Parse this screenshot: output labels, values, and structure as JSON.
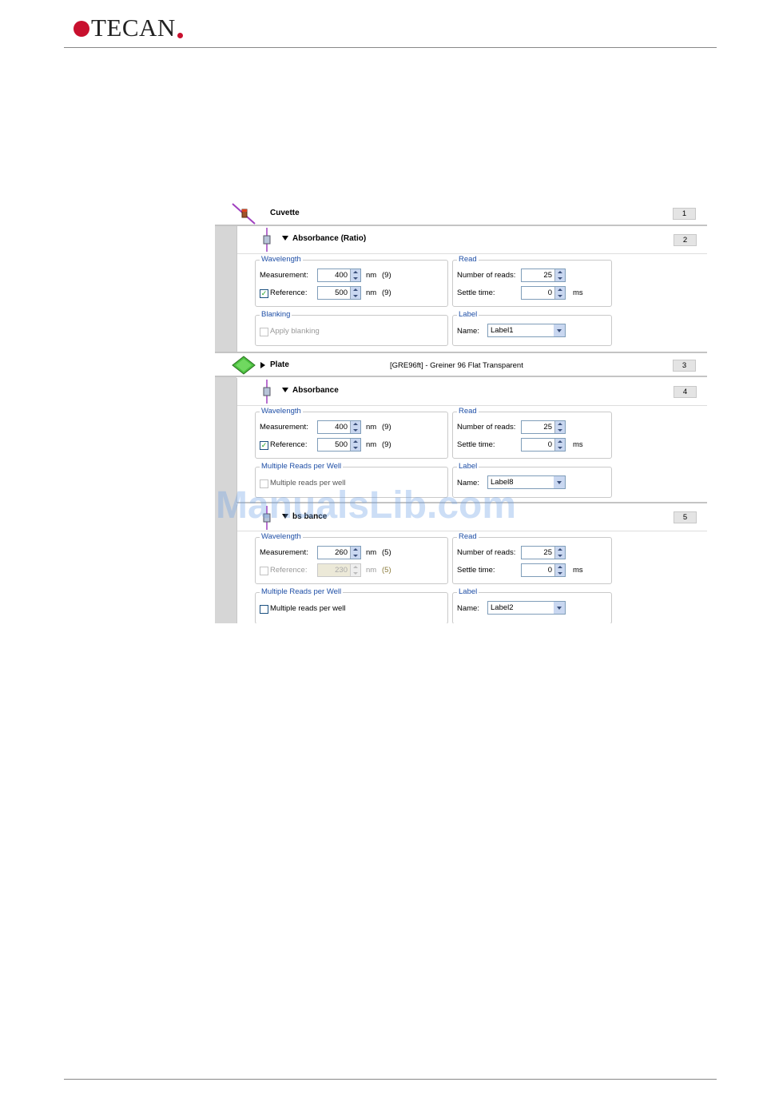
{
  "header": {
    "logo_text": "TECAN",
    "brand_color": "#c8102e"
  },
  "rows": [
    {
      "title": "Cuvette",
      "number": "1"
    },
    {
      "title": "Absorbance (Ratio)",
      "number": "2"
    },
    {
      "title": "Plate",
      "number": "3",
      "plate_desc": "[GRE96ft] - Greiner 96 Flat Transparent"
    },
    {
      "title": "Absorbance",
      "number": "4"
    },
    {
      "title": "bs  bance",
      "number": "5"
    }
  ],
  "panel1": {
    "wavelength_label": "Wavelength",
    "measurement_label": "Measurement:",
    "measurement_value": "400",
    "meas_unit": "nm",
    "meas_bw": "(9)",
    "reference_label": "Reference:",
    "reference_value": "500",
    "ref_unit": "nm",
    "ref_bw": "(9)",
    "reference_checked": "✓",
    "read_label": "Read",
    "reads_label": "Number of reads:",
    "reads_value": "25",
    "settle_label": "Settle time:",
    "settle_value": "0",
    "settle_unit": "ms",
    "blanking_label": "Blanking",
    "apply_blanking_label": "Apply blanking",
    "label_group": "Label",
    "name_label": "Name:",
    "name_value": "Label1"
  },
  "panel2": {
    "wavelength_label": "Wavelength",
    "measurement_label": "Measurement:",
    "measurement_value": "400",
    "meas_unit": "nm",
    "meas_bw": "(9)",
    "reference_label": "Reference:",
    "reference_value": "500",
    "ref_unit": "nm",
    "ref_bw": "(9)",
    "reference_checked": "✓",
    "read_label": "Read",
    "reads_label": "Number of reads:",
    "reads_value": "25",
    "settle_label": "Settle time:",
    "settle_value": "0",
    "settle_unit": "ms",
    "multi_label": "Multiple Reads per Well",
    "multi_check_label": "Multiple reads per well",
    "label_group": "Label",
    "name_label": "Name:",
    "name_value": "Label8"
  },
  "panel3": {
    "wavelength_label": "Wavelength",
    "measurement_label": "Measurement:",
    "measurement_value": "260",
    "meas_unit": "nm",
    "meas_bw": "(5)",
    "reference_label": "Reference:",
    "reference_value": "230",
    "ref_unit": "nm",
    "ref_bw": "(5)",
    "read_label": "Read",
    "reads_label": "Number of reads:",
    "reads_value": "25",
    "settle_label": "Settle time:",
    "settle_value": "0",
    "settle_unit": "ms",
    "multi_label": "Multiple Reads per Well",
    "multi_check_label": "Multiple reads per well",
    "label_group": "Label",
    "name_label": "Name:",
    "name_value": "Label2"
  },
  "watermark": "ManualsLib.com"
}
